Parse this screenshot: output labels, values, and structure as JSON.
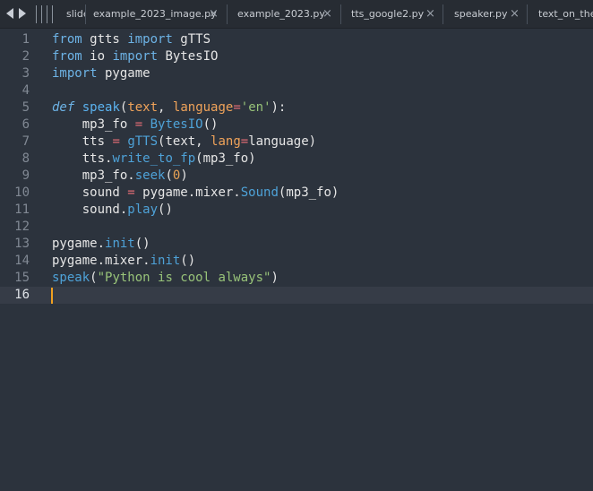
{
  "tabs": [
    {
      "label": "slide",
      "active": false
    },
    {
      "label": "example_2023_image.py",
      "active": false
    },
    {
      "label": "example_2023.py",
      "active": false
    },
    {
      "label": "tts_google2.py",
      "active": false
    },
    {
      "label": "speaker.py",
      "active": false
    },
    {
      "label": "text_on_the_",
      "active": false
    }
  ],
  "close_glyph": "×",
  "editor": {
    "current_line": 16,
    "line_numbers": [
      "1",
      "2",
      "3",
      "4",
      "5",
      "6",
      "7",
      "8",
      "9",
      "10",
      "11",
      "12",
      "13",
      "14",
      "15",
      "16"
    ],
    "lines": [
      [
        {
          "t": "from",
          "c": "kw"
        },
        {
          "t": " gtts ",
          "c": "plain"
        },
        {
          "t": "import",
          "c": "kw"
        },
        {
          "t": " gTTS",
          "c": "plain"
        }
      ],
      [
        {
          "t": "from",
          "c": "kw"
        },
        {
          "t": " io ",
          "c": "plain"
        },
        {
          "t": "import",
          "c": "kw"
        },
        {
          "t": " BytesIO",
          "c": "plain"
        }
      ],
      [
        {
          "t": "import",
          "c": "kw"
        },
        {
          "t": " pygame",
          "c": "plain"
        }
      ],
      [],
      [
        {
          "t": "def",
          "c": "def"
        },
        {
          "t": " ",
          "c": "plain"
        },
        {
          "t": "speak",
          "c": "fn"
        },
        {
          "t": "(",
          "c": "plain"
        },
        {
          "t": "text",
          "c": "par"
        },
        {
          "t": ", ",
          "c": "plain"
        },
        {
          "t": "language",
          "c": "par"
        },
        {
          "t": "=",
          "c": "op"
        },
        {
          "t": "'en'",
          "c": "str"
        },
        {
          "t": "):",
          "c": "plain"
        }
      ],
      [
        {
          "t": "    mp3_fo ",
          "c": "plain"
        },
        {
          "t": "=",
          "c": "op"
        },
        {
          "t": " ",
          "c": "plain"
        },
        {
          "t": "BytesIO",
          "c": "mth"
        },
        {
          "t": "()",
          "c": "plain"
        }
      ],
      [
        {
          "t": "    tts ",
          "c": "plain"
        },
        {
          "t": "=",
          "c": "op"
        },
        {
          "t": " ",
          "c": "plain"
        },
        {
          "t": "gTTS",
          "c": "mth"
        },
        {
          "t": "(text, ",
          "c": "plain"
        },
        {
          "t": "lang",
          "c": "par"
        },
        {
          "t": "=",
          "c": "op"
        },
        {
          "t": "language)",
          "c": "plain"
        }
      ],
      [
        {
          "t": "    tts.",
          "c": "plain"
        },
        {
          "t": "write_to_fp",
          "c": "mth"
        },
        {
          "t": "(mp3_fo)",
          "c": "plain"
        }
      ],
      [
        {
          "t": "    mp3_fo.",
          "c": "plain"
        },
        {
          "t": "seek",
          "c": "mth"
        },
        {
          "t": "(",
          "c": "plain"
        },
        {
          "t": "0",
          "c": "num"
        },
        {
          "t": ")",
          "c": "plain"
        }
      ],
      [
        {
          "t": "    sound ",
          "c": "plain"
        },
        {
          "t": "=",
          "c": "op"
        },
        {
          "t": " pygame.mixer.",
          "c": "plain"
        },
        {
          "t": "Sound",
          "c": "mth"
        },
        {
          "t": "(mp3_fo)",
          "c": "plain"
        }
      ],
      [
        {
          "t": "    sound.",
          "c": "plain"
        },
        {
          "t": "play",
          "c": "mth"
        },
        {
          "t": "()",
          "c": "plain"
        }
      ],
      [],
      [
        {
          "t": "pygame.",
          "c": "plain"
        },
        {
          "t": "init",
          "c": "mth"
        },
        {
          "t": "()",
          "c": "plain"
        }
      ],
      [
        {
          "t": "pygame.mixer.",
          "c": "plain"
        },
        {
          "t": "init",
          "c": "mth"
        },
        {
          "t": "()",
          "c": "plain"
        }
      ],
      [
        {
          "t": "speak",
          "c": "mth"
        },
        {
          "t": "(",
          "c": "plain"
        },
        {
          "t": "\"Python is cool always\"",
          "c": "str"
        },
        {
          "t": ")",
          "c": "plain"
        }
      ],
      []
    ]
  }
}
